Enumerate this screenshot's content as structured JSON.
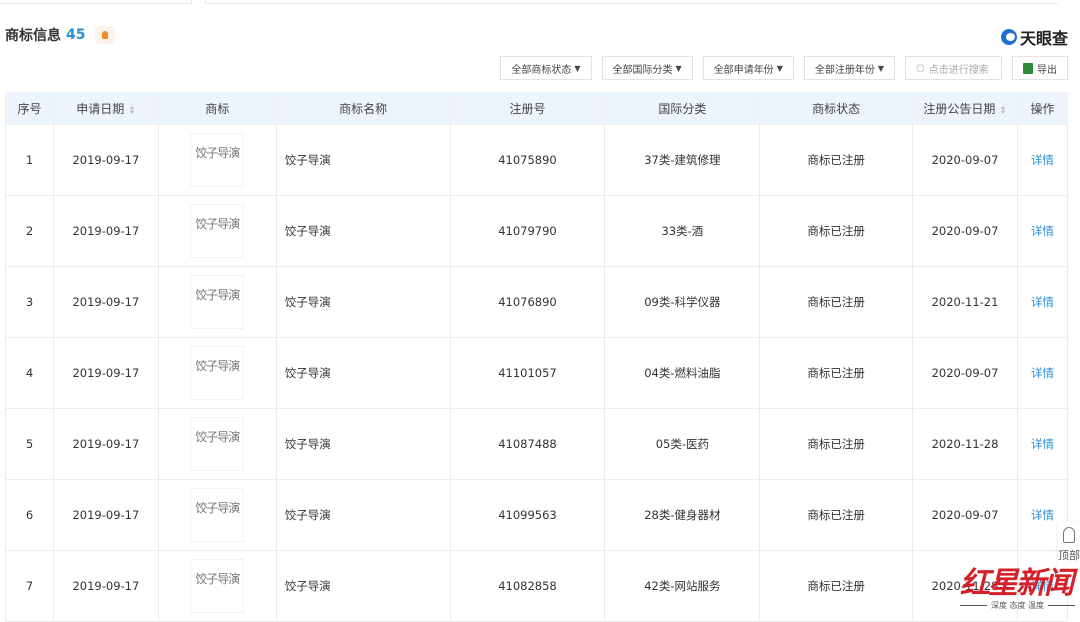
{
  "section": {
    "title": "商标信息",
    "count": "45"
  },
  "logo": {
    "text": "天眼查"
  },
  "toolbar": {
    "filters": [
      "全部商标状态",
      "全部国际分类",
      "全部申请年份",
      "全部注册年份"
    ],
    "search_placeholder": "点击进行搜索",
    "export_label": "导出"
  },
  "table": {
    "headers": [
      "序号",
      "申请日期",
      "商标",
      "商标名称",
      "注册号",
      "国际分类",
      "商标状态",
      "注册公告日期",
      "操作"
    ],
    "rows": [
      {
        "no": "1",
        "apply_date": "2019-09-17",
        "mark": "饺子导演",
        "name": "饺子导演",
        "reg_no": "41075890",
        "class": "37类-建筑修理",
        "status": "商标已注册",
        "pub_date": "2020-09-07",
        "action": "详情"
      },
      {
        "no": "2",
        "apply_date": "2019-09-17",
        "mark": "饺子导演",
        "name": "饺子导演",
        "reg_no": "41079790",
        "class": "33类-酒",
        "status": "商标已注册",
        "pub_date": "2020-09-07",
        "action": "详情"
      },
      {
        "no": "3",
        "apply_date": "2019-09-17",
        "mark": "饺子导演",
        "name": "饺子导演",
        "reg_no": "41076890",
        "class": "09类-科学仪器",
        "status": "商标已注册",
        "pub_date": "2020-11-21",
        "action": "详情"
      },
      {
        "no": "4",
        "apply_date": "2019-09-17",
        "mark": "饺子导演",
        "name": "饺子导演",
        "reg_no": "41101057",
        "class": "04类-燃料油脂",
        "status": "商标已注册",
        "pub_date": "2020-09-07",
        "action": "详情"
      },
      {
        "no": "5",
        "apply_date": "2019-09-17",
        "mark": "饺子导演",
        "name": "饺子导演",
        "reg_no": "41087488",
        "class": "05类-医药",
        "status": "商标已注册",
        "pub_date": "2020-11-28",
        "action": "详情"
      },
      {
        "no": "6",
        "apply_date": "2019-09-17",
        "mark": "饺子导演",
        "name": "饺子导演",
        "reg_no": "41099563",
        "class": "28类-健身器材",
        "status": "商标已注册",
        "pub_date": "2020-09-07",
        "action": "详情"
      },
      {
        "no": "7",
        "apply_date": "2019-09-17",
        "mark": "饺子导演",
        "name": "饺子导演",
        "reg_no": "41082858",
        "class": "42类-网站服务",
        "status": "商标已注册",
        "pub_date": "2020-11-28",
        "action": "详情"
      }
    ]
  },
  "to_top": {
    "label": "顶部"
  },
  "watermark": {
    "main": "红星新闻",
    "sub": "深度 态度 温度"
  },
  "colors": {
    "accent": "#2a8fd8",
    "header_bg": "#edf4fb",
    "badge": "#f08b2c",
    "watermark": "#d4202a"
  }
}
